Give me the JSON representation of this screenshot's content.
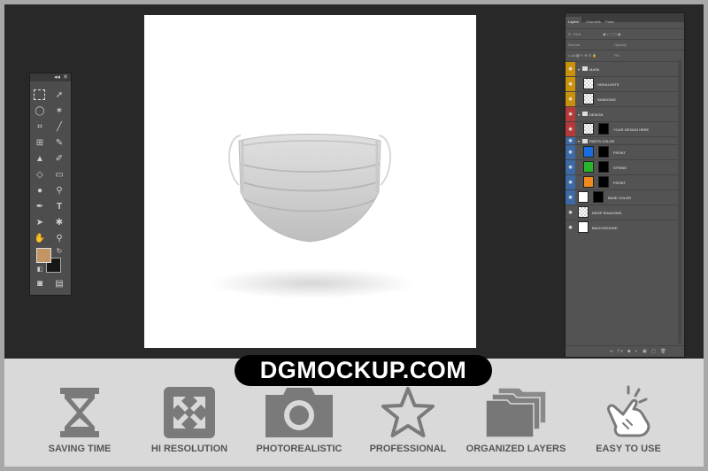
{
  "layers_panel": {
    "tabs": [
      "Layers",
      "Channels",
      "Paths"
    ],
    "filter_kind": "Kind",
    "blend_mode": "Normal",
    "opacity_label": "Opacity:",
    "fill_label": "Fill:",
    "lock_label": "Lock:",
    "layers": [
      {
        "name": "MASK",
        "type": "group",
        "color": "#c9920a"
      },
      {
        "name": "HIGHLIGHTS",
        "type": "layer",
        "color": "#c9920a"
      },
      {
        "name": "SHADOWS",
        "type": "layer",
        "color": "#c9920a"
      },
      {
        "name": "DESIGN",
        "type": "group",
        "color": "#b73a3a"
      },
      {
        "name": "YOUR DESIGN HERE",
        "type": "smart-object",
        "color": "#b73a3a"
      },
      {
        "name": "PARTS COLOR",
        "type": "group",
        "color": "#3c6aa7"
      },
      {
        "name": "FRONT",
        "type": "fill-layer",
        "color": "#3c6aa7",
        "swatch": "#1a6de0"
      },
      {
        "name": "STRING",
        "type": "fill-layer",
        "color": "#3c6aa7",
        "swatch": "#27b52b"
      },
      {
        "name": "FRONT",
        "type": "fill-layer",
        "color": "#3c6aa7",
        "swatch": "#f08a1e"
      },
      {
        "name": "BASE COLOR",
        "type": "fill-layer",
        "color": "#3c6aa7",
        "swatch": "#ffffff"
      },
      {
        "name": "DROP SHADOWS",
        "type": "layer",
        "color": ""
      },
      {
        "name": "BACKGROUND",
        "type": "layer",
        "color": ""
      }
    ]
  },
  "tools": {
    "foreground_color": "#c49563",
    "background_color": "#161616"
  },
  "brand": {
    "text": "DGMOCKUP.COM"
  },
  "features": [
    {
      "label": "SAVING TIME",
      "icon": "hourglass-icon"
    },
    {
      "label": "HI RESOLUTION",
      "icon": "expand-arrows-icon"
    },
    {
      "label": "PHOTOREALISTIC",
      "icon": "camera-icon"
    },
    {
      "label": "PROFESSIONAL",
      "icon": "star-icon"
    },
    {
      "label": "ORGANIZED LAYERS",
      "icon": "folders-icon"
    },
    {
      "label": "EASY TO USE",
      "icon": "click-hand-icon"
    }
  ]
}
